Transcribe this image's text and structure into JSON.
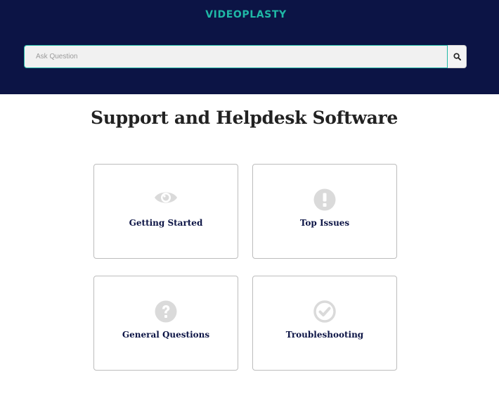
{
  "header": {
    "logo_text": "VIDEOPLASTY",
    "logo_color": "#1fb8a6",
    "background_color": "#0c1445"
  },
  "search": {
    "placeholder": "Ask Question",
    "value": "",
    "button_icon": "search-icon"
  },
  "main": {
    "title": "Support and Helpdesk Software"
  },
  "categories": [
    {
      "label": "Getting Started",
      "icon": "eye-icon"
    },
    {
      "label": "Top Issues",
      "icon": "exclamation-circle-icon"
    },
    {
      "label": "General Questions",
      "icon": "question-circle-icon"
    },
    {
      "label": "Troubleshooting",
      "icon": "check-circle-icon"
    }
  ],
  "icon_color": "#dadada"
}
